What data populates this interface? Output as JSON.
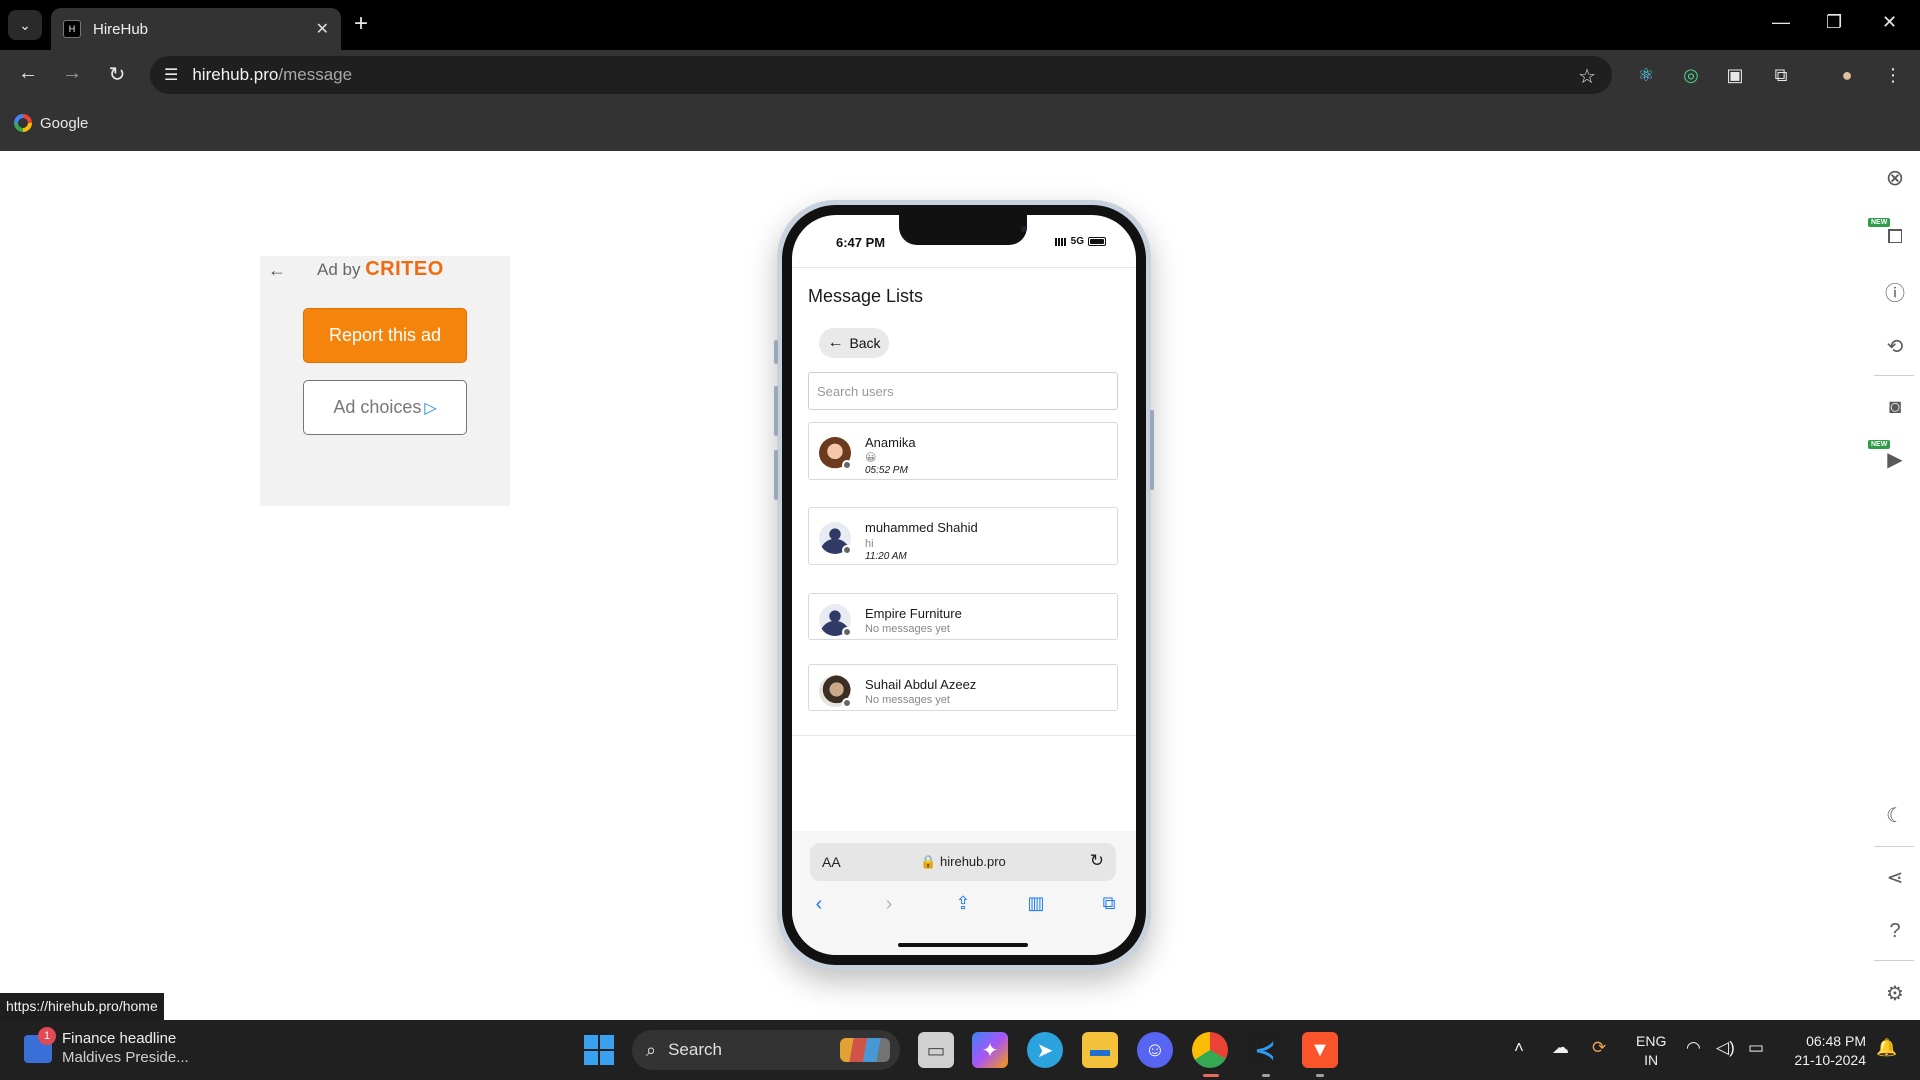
{
  "browser": {
    "tab_title": "HireHub",
    "tab_favicon": "H",
    "url_host": "hirehub.pro",
    "url_path": "/message",
    "bookmark_google": "Google",
    "status_url": "https://hirehub.pro/home"
  },
  "ad": {
    "by_label": "Ad by",
    "brand": "CRITEO",
    "report_label": "Report this ad",
    "choices_label": "Ad choices"
  },
  "phone": {
    "status_time": "6:47 PM",
    "network": "5G",
    "page_title": "Message Lists",
    "back_label": "Back",
    "search_placeholder": "Search users",
    "conversations": [
      {
        "name": "Anamika",
        "preview": "😀",
        "time": "05:52 PM"
      },
      {
        "name": "muhammed Shahid",
        "preview": "hi",
        "time": "11:20 AM"
      },
      {
        "name": "Empire Furniture",
        "preview": "No messages yet"
      },
      {
        "name": "Suhail Abdul Azeez",
        "preview": "No messages yet"
      }
    ],
    "safari_aa": "AA",
    "safari_host": "hirehub.pro"
  },
  "taskbar": {
    "news_title": "Finance headline",
    "news_subtitle": "Maldives Preside...",
    "news_badge": "1",
    "search_label": "Search",
    "lang_line1": "ENG",
    "lang_line2": "IN",
    "time": "06:48 PM",
    "date": "21-10-2024"
  },
  "tools": {
    "new_badge": "NEW"
  },
  "colors": {
    "ad_button": "#f5840c",
    "criteo_brand": "#f26a0f",
    "ios_blue": "#1a7cf5",
    "taskbar": "#202020"
  }
}
